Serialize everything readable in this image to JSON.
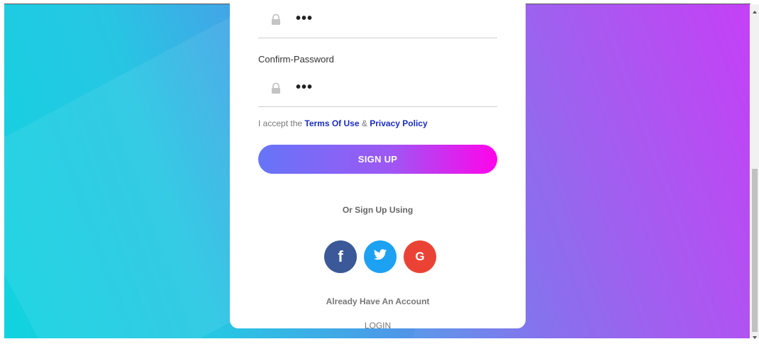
{
  "form": {
    "password_masked": "•••",
    "confirm_label": "Confirm-Password",
    "confirm_masked": "•••",
    "terms_prefix": "I accept the",
    "terms_link": "Terms Of Use",
    "terms_amp": "&",
    "privacy_link": "Privacy Policy",
    "signup_label": "SIGN UP",
    "or_text": "Or Sign Up Using",
    "already_text": "Already Have An Account",
    "login_label": "LOGIN"
  },
  "social": {
    "facebook_glyph": "f",
    "google_glyph": "G"
  },
  "colors": {
    "gradient_start": "#11d3df",
    "gradient_end": "#c236f6",
    "button_start": "#6675f8",
    "button_end": "#ff04ea",
    "link": "#1a2dbd",
    "facebook": "#3b5998",
    "twitter": "#1da1f2",
    "google": "#ea4335"
  },
  "icons": [
    "lock-icon",
    "facebook-icon",
    "twitter-icon",
    "google-icon",
    "scroll-up-icon",
    "scroll-down-icon"
  ]
}
